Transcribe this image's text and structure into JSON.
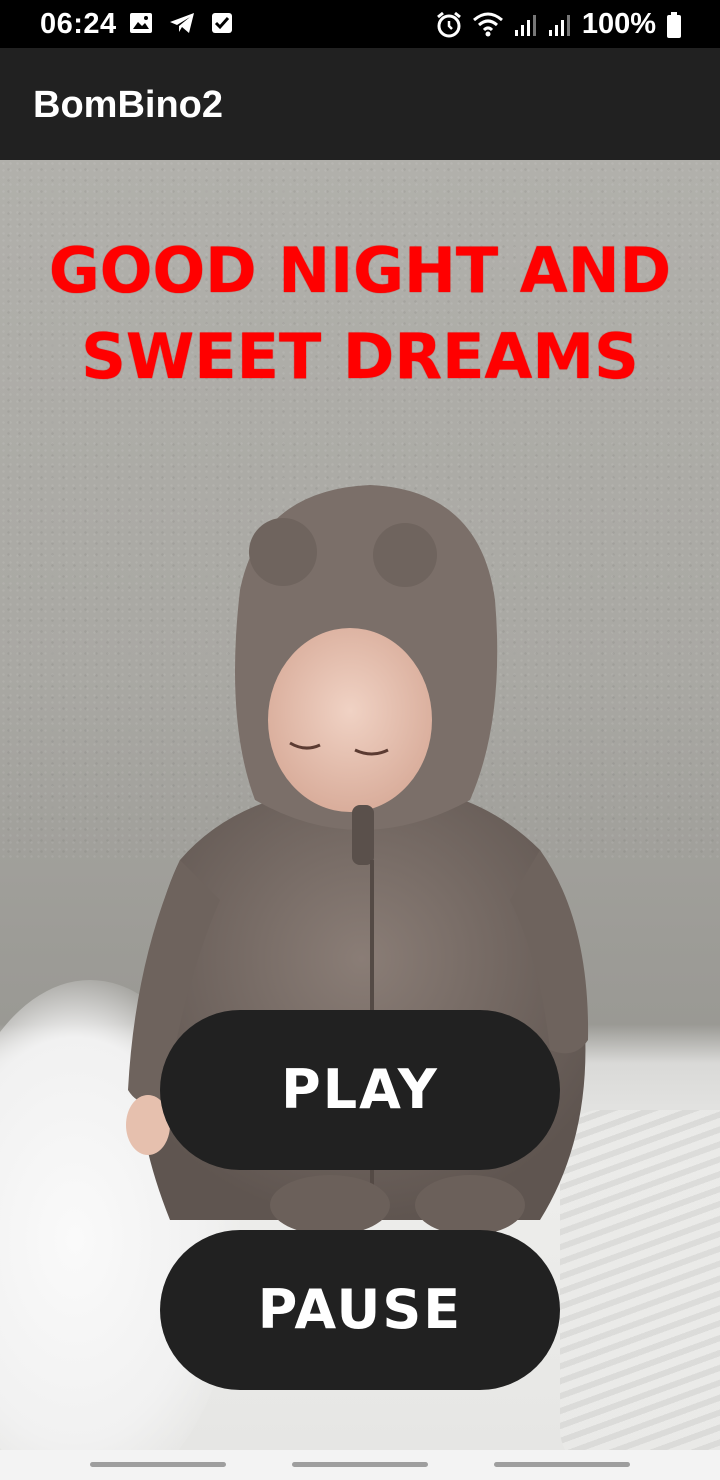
{
  "status_bar": {
    "time": "06:24",
    "battery": "100%",
    "icons_left": [
      "image-icon",
      "telegram-icon",
      "checkbox-icon"
    ],
    "icons_right": [
      "alarm-icon",
      "wifi-icon",
      "signal-icon",
      "signal-icon",
      "battery-icon"
    ]
  },
  "app_bar": {
    "title": "BomBino2"
  },
  "main": {
    "headline_line1": "GOOD NIGHT AND",
    "headline_line2": "SWEET DREAMS",
    "headline_color": "#ff0000",
    "play_label": "PLAY",
    "pause_label": "PAUSE",
    "button_color": "#212121"
  }
}
